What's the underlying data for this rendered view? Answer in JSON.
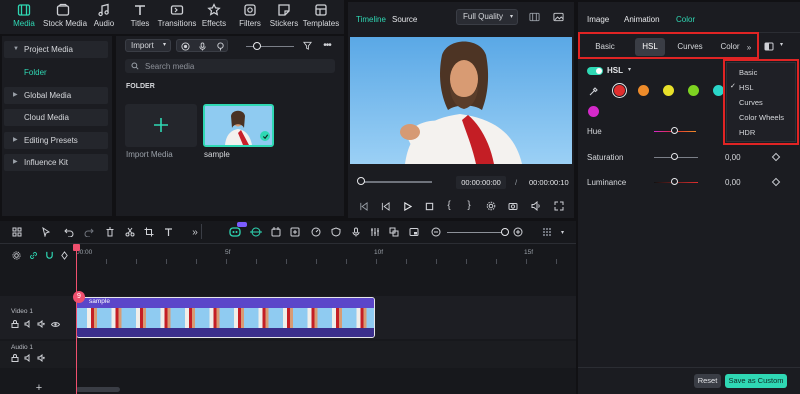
{
  "toolbar": {
    "items": [
      {
        "label": "Media",
        "icon": "media-icon",
        "active": true
      },
      {
        "label": "Stock Media",
        "icon": "stock-media-icon"
      },
      {
        "label": "Audio",
        "icon": "audio-icon"
      },
      {
        "label": "Titles",
        "icon": "titles-icon"
      },
      {
        "label": "Transitions",
        "icon": "transitions-icon"
      },
      {
        "label": "Effects",
        "icon": "effects-icon"
      },
      {
        "label": "Filters",
        "icon": "filters-icon"
      },
      {
        "label": "Stickers",
        "icon": "stickers-icon"
      },
      {
        "label": "Templates",
        "icon": "templates-icon"
      }
    ]
  },
  "left_nav": {
    "items": [
      {
        "label": "Project Media",
        "expanded": true
      },
      {
        "label": "Folder",
        "sub": true,
        "selected": true
      },
      {
        "label": "Global Media"
      },
      {
        "label": "Cloud Media"
      },
      {
        "label": "Editing Presets"
      },
      {
        "label": "Influence Kit"
      }
    ]
  },
  "media": {
    "import_label": "Import",
    "search_placeholder": "Search media",
    "folder_header": "FOLDER",
    "import_tile_label": "Import Media",
    "clip_label": "sample"
  },
  "player": {
    "tab_timeline": "Timeline",
    "tab_source": "Source",
    "quality": "Full Quality",
    "current_time": "00:00:00:00",
    "separator": "/",
    "total_time": "00:00:00:10"
  },
  "right_panel": {
    "tabs": [
      "Image",
      "Animation",
      "Color"
    ],
    "active_tab": "Color",
    "segments": [
      "Basic",
      "HSL",
      "Curves",
      "Color"
    ],
    "active_segment": "HSL",
    "hsl_toggle_label": "HSL",
    "swatch_colors": [
      "#e02e2e",
      "#ee8b2a",
      "#e8e02a",
      "#7ed321",
      "#2ad6c9",
      "#d429c9"
    ],
    "sliders": [
      {
        "label": "Hue",
        "value": null
      },
      {
        "label": "Saturation",
        "value": "0,00"
      },
      {
        "label": "Luminance",
        "value": "0,00"
      }
    ],
    "reset_label": "Reset",
    "save_label": "Save as Custom",
    "accent": "#2fd8b4"
  },
  "dropdown": {
    "items": [
      "Basic",
      "HSL",
      "Curves",
      "Color Wheels",
      "HDR"
    ],
    "checked": "HSL"
  },
  "timeline": {
    "ruler": [
      "00:00",
      "5f",
      "10f",
      "15f"
    ],
    "video_track_label": "Video 1",
    "audio_track_label": "Audio 1",
    "clip_label": "sample",
    "playhead_badge": "9"
  }
}
